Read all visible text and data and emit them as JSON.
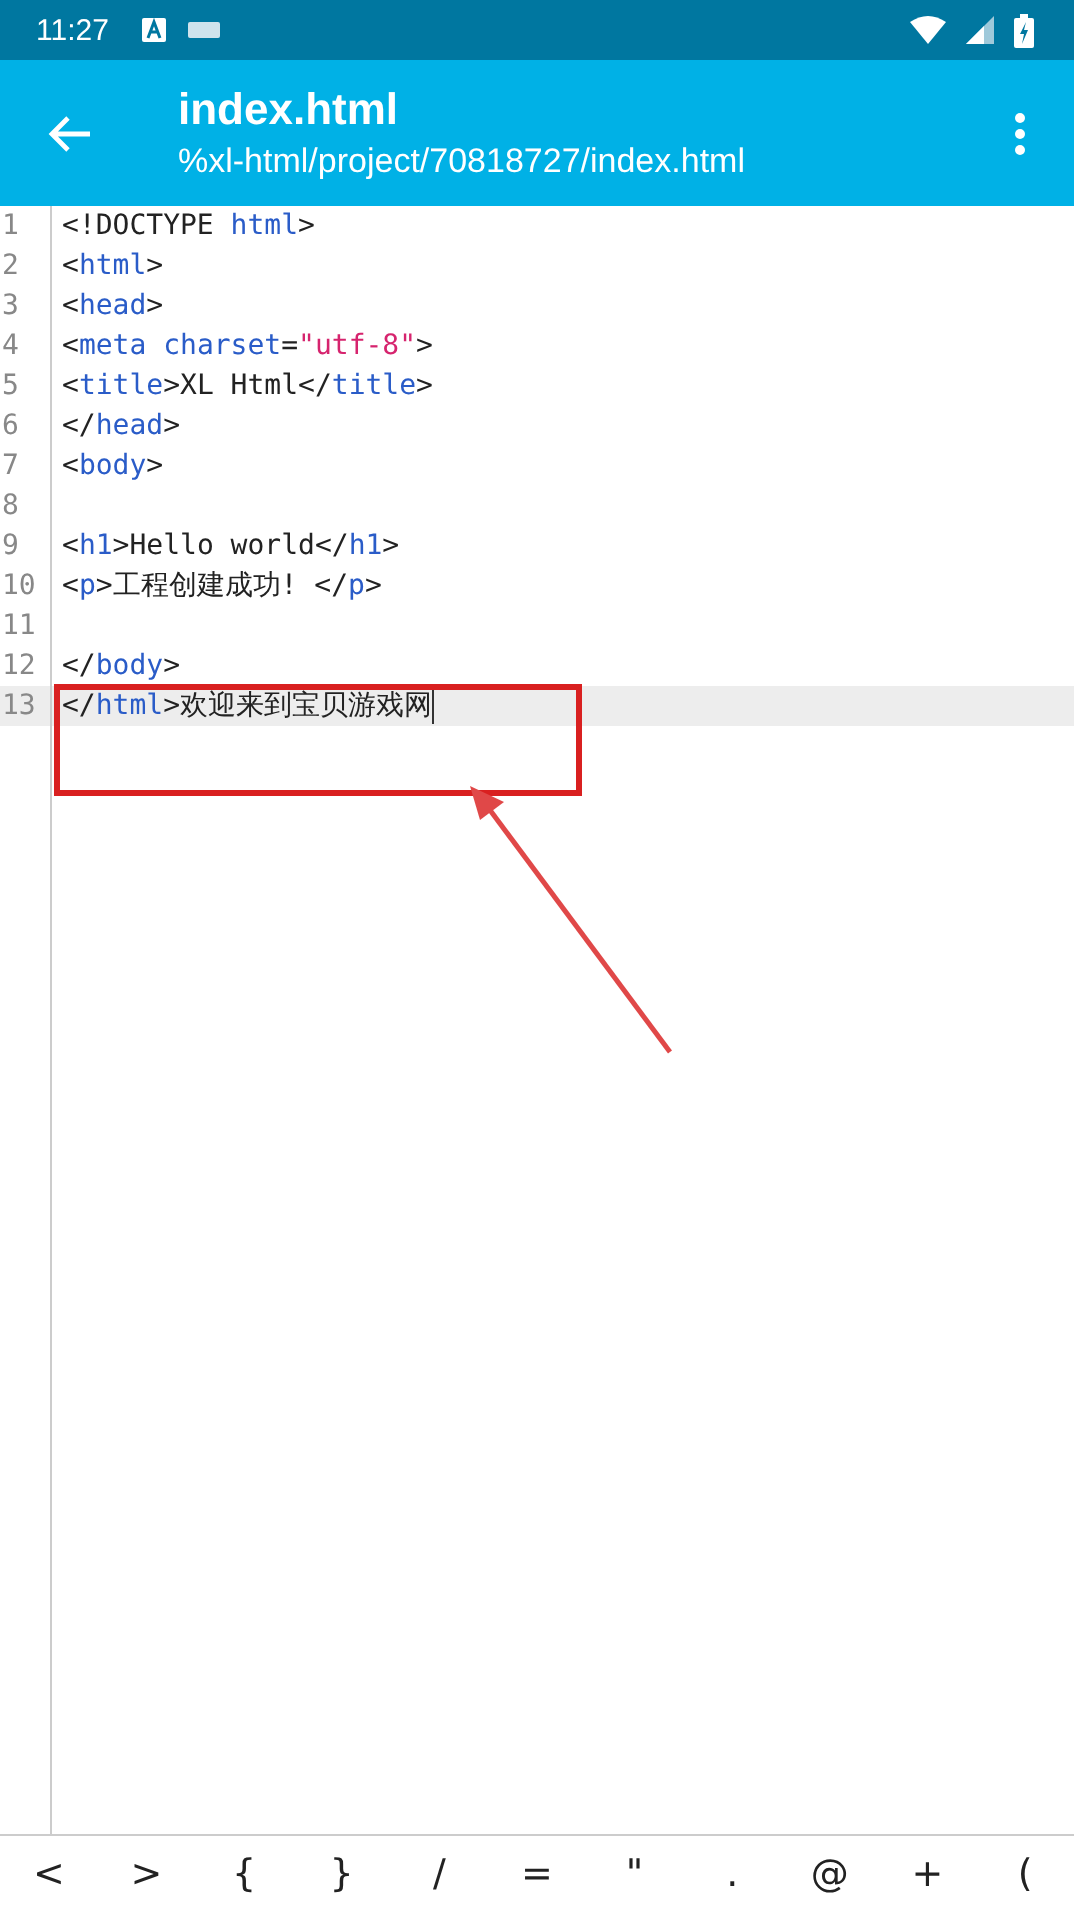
{
  "status_bar": {
    "time": "11:27"
  },
  "app_bar": {
    "title": "index.html",
    "subtitle": "%xl-html/project/70818727/index.html"
  },
  "editor": {
    "lines": [
      {
        "number": "1",
        "current": false,
        "tokens": [
          {
            "text": "<!DOCTYPE ",
            "kind": "plain"
          },
          {
            "text": "html",
            "kind": "keyword"
          },
          {
            "text": ">",
            "kind": "plain"
          }
        ]
      },
      {
        "number": "2",
        "current": false,
        "tokens": [
          {
            "text": "<",
            "kind": "plain"
          },
          {
            "text": "html",
            "kind": "keyword"
          },
          {
            "text": ">",
            "kind": "plain"
          }
        ]
      },
      {
        "number": "3",
        "current": false,
        "tokens": [
          {
            "text": "<",
            "kind": "plain"
          },
          {
            "text": "head",
            "kind": "keyword"
          },
          {
            "text": ">",
            "kind": "plain"
          }
        ]
      },
      {
        "number": "4",
        "current": false,
        "tokens": [
          {
            "text": "<",
            "kind": "plain"
          },
          {
            "text": "meta charset",
            "kind": "keyword"
          },
          {
            "text": "=",
            "kind": "plain"
          },
          {
            "text": "\"utf-8\"",
            "kind": "string"
          },
          {
            "text": ">",
            "kind": "plain"
          }
        ]
      },
      {
        "number": "5",
        "current": false,
        "tokens": [
          {
            "text": "<",
            "kind": "plain"
          },
          {
            "text": "title",
            "kind": "keyword"
          },
          {
            "text": ">XL Html</",
            "kind": "plain"
          },
          {
            "text": "title",
            "kind": "keyword"
          },
          {
            "text": ">",
            "kind": "plain"
          }
        ]
      },
      {
        "number": "6",
        "current": false,
        "tokens": [
          {
            "text": "</",
            "kind": "plain"
          },
          {
            "text": "head",
            "kind": "keyword"
          },
          {
            "text": ">",
            "kind": "plain"
          }
        ]
      },
      {
        "number": "7",
        "current": false,
        "tokens": [
          {
            "text": "<",
            "kind": "plain"
          },
          {
            "text": "body",
            "kind": "keyword"
          },
          {
            "text": ">",
            "kind": "plain"
          }
        ]
      },
      {
        "number": "8",
        "current": false
      },
      {
        "number": "9",
        "current": false,
        "tokens": [
          {
            "text": "<",
            "kind": "plain"
          },
          {
            "text": "h1",
            "kind": "keyword"
          },
          {
            "text": ">Hello world</",
            "kind": "plain"
          },
          {
            "text": "h1",
            "kind": "keyword"
          },
          {
            "text": ">",
            "kind": "plain"
          }
        ]
      },
      {
        "number": "10",
        "current": false,
        "tokens": [
          {
            "text": "<",
            "kind": "plain"
          },
          {
            "text": "p",
            "kind": "keyword"
          },
          {
            "text": ">工程创建成功! </",
            "kind": "plain"
          },
          {
            "text": "p",
            "kind": "keyword"
          },
          {
            "text": ">",
            "kind": "plain"
          }
        ]
      },
      {
        "number": "11",
        "current": false
      },
      {
        "number": "12",
        "current": false,
        "tokens": [
          {
            "text": "</",
            "kind": "plain"
          },
          {
            "text": "body",
            "kind": "keyword"
          },
          {
            "text": ">",
            "kind": "plain"
          }
        ]
      },
      {
        "number": "13",
        "current": true,
        "tokens": [
          {
            "text": "</",
            "kind": "plain"
          },
          {
            "text": "html",
            "kind": "keyword"
          },
          {
            "text": ">欢迎来到宝贝游戏网",
            "kind": "plain"
          }
        ]
      }
    ]
  },
  "symbol_keys": [
    "<",
    ">",
    "{",
    "}",
    "/",
    "=",
    "\"",
    ".",
    "@",
    "+",
    "("
  ]
}
